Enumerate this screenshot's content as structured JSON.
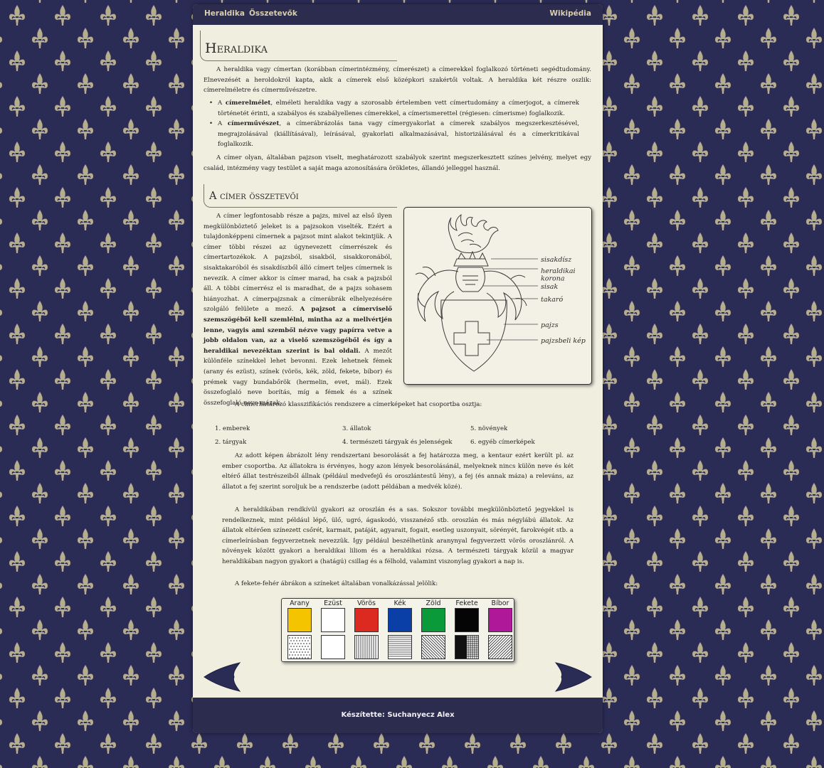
{
  "nav": {
    "left_links": [
      "Heraldika",
      "Összetevők"
    ],
    "right_link": "Wikipédia"
  },
  "section1": {
    "title": "Heraldika",
    "intro": "A heraldika vagy címertan (korábban címerintézmény, címerészet) a címerekkel foglalkozó történeti segédtudomány. Elnevezését a heroldokról kapta, akik a címerek első középkori szakértői voltak. A heraldika két részre oszlik: címerelméletre és címerművészetre.",
    "bullets": [
      {
        "bold": "címerelmélet",
        "before": "A ",
        "after": ", elméleti heraldika vagy a szorosabb értelemben vett címertudomány a címerjogot, a címerek történetét érinti, a szabályos és szabályellenes címerekkel, a címerismerettel (régiesen: címerisme) foglalkozik."
      },
      {
        "bold": "címerművészet",
        "before": "A ",
        "after": ", a címerábrázolás tana vagy címergyakorlat a címerek szabályos megszerkesztésével, megrajzolásával (kiállításával), leírásával, gyakorlati alkalmazásával, historizálásával és a címerkritikával foglalkozik."
      }
    ],
    "definition": "A címer olyan, általában pajzson viselt, meghatározott szabályok szerint megszerkesztett színes jelvény, melyet egy család, intézmény vagy testület a saját maga azonosítására örökletes, állandó jelleggel használ."
  },
  "section2": {
    "title": "A címer összetevői",
    "para_part1": "A címer legfontosabb része a pajzs, mivel az első ilyen megkülönböztető jeleket is a pajzsokon viselték. Ezért a tulajdonképpeni címernek a pajzsot mint alakot tekintjük. A címer többi részei az úgynevezett címerrészek és címertartozékok. A pajzsból, sisakból, sisakkoronából, sisaktakaróból és sisakdíszből álló címert teljes címernek is nevezik. A címer akkor is címer marad, ha csak a pajzsból áll. A többi címerrész el is maradhat, de a pajzs sohasem hiányozhat. A címerpajzsnak a címerábrák elhelyezésére szolgáló felülete a mező. ",
    "para_bold": "A pajzsot a címerviselő szemszögéből kell szemlélni, mintha az a mellvértjén lenne, vagyis ami szemből nézve vagy papírra vetve a jobb oldalon van, az a viselő szemszögéből és így a heraldikai nevezéktan szerint is bal oldali.",
    "para_part2": " A mezőt különféle színekkel lehet bevonni. Ezek lehetnek fémek (arany és ezüst), színek (vörös, kék, zöld, fekete, bíbor) és prémek vagy bundabőrök (hermelin, evet, mál). Ezek összefoglaló neve borítás, míg a fémek és a színek összefoglaló neve mázak.",
    "figure_labels": [
      "sisakdísz",
      "heraldikai korona",
      "sisak",
      "takaró",
      "pajzs",
      "pajzsbeli kép"
    ],
    "classification_intro": "A címerhatározó klasszifikációs rendszere a címerképeket hat csoportba osztja:",
    "classes": [
      "1. emberek",
      "2. tárgyak",
      "3. állatok",
      "4. természeti tárgyak és jelenségek",
      "5. növények",
      "6. egyéb címerképek"
    ],
    "para_creature": "Az adott képen ábrázolt lény rendszertani besorolását a fej határozza meg, a kentaur ezért került pl. az ember csoportba. Az állatokra is érvényes, hogy azon lények besorolásánál, melyeknek nincs külön neve és két eltérő állat testrészeiből állnak (például medvefejű és oroszlántestű lény), a fej (és annak máza) a releváns, az állatot a fej szerint soroljuk be a rendszerbe (adott példában a medvék közé).",
    "para_animals": "A heraldikában rendkívül gyakori az oroszlán és a sas. Sokszor további megkülönböztető jegyekkel is rendelkeznek, mint például lépő, ülő, ugró, ágaskodó, visszanéző stb. oroszlán és más négylábú állatok. Az állatok eltérően színezett csőrét, karmait, patáját, agyarait, fogait, esetleg uszonyait, sörényét, farokvégét stb. a címerleírásban fegyverzetnek nevezzük. Így például beszélhetünk aranynyal fegyverzett vörös oroszlánról. A növények között gyakori a heraldikai liliom és a heraldikai rózsa. A természeti tárgyak közül a magyar heraldikában nagyon gyakori a (hatágú) csillag és a félhold, valamint viszonylag gyakori a nap is.",
    "tincture_intro": "A fekete-fehér ábrákon a színeket általában vonalkázással jelölik:",
    "tinctures": [
      {
        "name": "Arany",
        "color": "#f5c400",
        "hatch": "dots"
      },
      {
        "name": "Ezüst",
        "color": "#ffffff",
        "hatch": "plain"
      },
      {
        "name": "Vörös",
        "color": "#dc2a20",
        "hatch": "vertical"
      },
      {
        "name": "Kék",
        "color": "#0a3fa8",
        "hatch": "horizontal"
      },
      {
        "name": "Zöld",
        "color": "#0a9a3a",
        "hatch": "diag-down"
      },
      {
        "name": "Fekete",
        "color": "#050505",
        "hatch": "fekete"
      },
      {
        "name": "Bíbor",
        "color": "#b0189a",
        "hatch": "diag-up"
      }
    ]
  },
  "footer": {
    "credit": "Készítette: Suchanyecz Alex"
  },
  "colors": {
    "background": "#2b2c55",
    "fleur": "#b6ad90",
    "page": "#efeedf",
    "bars": "#2b2c4e",
    "nav_text": "#d9cfae"
  }
}
